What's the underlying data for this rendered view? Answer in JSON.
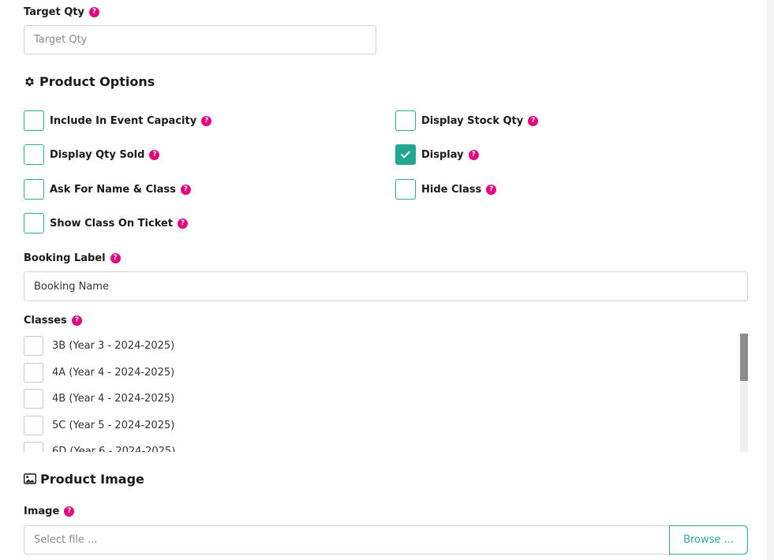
{
  "target_qty": {
    "label": "Target Qty",
    "help": "?",
    "placeholder": "Target Qty"
  },
  "product_options": {
    "title": "Product Options",
    "icon": "gear-icon",
    "options": [
      {
        "label": "Include In Event Capacity",
        "checked": false
      },
      {
        "label": "Display Stock Qty",
        "checked": false
      },
      {
        "label": "Display Qty Sold",
        "checked": false
      },
      {
        "label": "Display",
        "checked": true
      },
      {
        "label": "Ask For Name & Class",
        "checked": false
      },
      {
        "label": "Hide Class",
        "checked": false
      },
      {
        "label": "Show Class On Ticket",
        "checked": false
      }
    ]
  },
  "booking_label": {
    "label": "Booking Label",
    "value": "Booking Name"
  },
  "classes": {
    "label": "Classes",
    "items": [
      {
        "label": "3B (Year 3 - 2024-2025)",
        "checked": false
      },
      {
        "label": "4A (Year 4 - 2024-2025)",
        "checked": false
      },
      {
        "label": "4B (Year 4 - 2024-2025)",
        "checked": false
      },
      {
        "label": "5C (Year 5 - 2024-2025)",
        "checked": false
      },
      {
        "label": "6D (Year 6 - 2024-2025)",
        "checked": false
      }
    ]
  },
  "product_image": {
    "title": "Product Image",
    "icon": "image-icon"
  },
  "image": {
    "label": "Image",
    "placeholder": "Select file ...",
    "browse_label": "Browse ..."
  },
  "colors": {
    "accent": "#21a68f",
    "help_badge": "#e6007e"
  }
}
